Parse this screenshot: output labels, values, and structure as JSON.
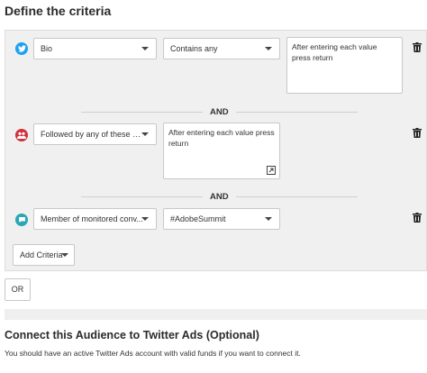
{
  "page": {
    "title": "Define the criteria"
  },
  "criteria": [
    {
      "icon": "twitter-bird-icon",
      "field": "Bio",
      "operator": "Contains any",
      "value_placeholder": "After entering each value press return"
    },
    {
      "icon": "followers-icon",
      "field": "Followed by any of these a...",
      "value_placeholder": "After entering each value press return"
    },
    {
      "icon": "monitored-conversation-icon",
      "field": "Member of monitored conv...",
      "value": "#AdobeSummit"
    }
  ],
  "connectors": [
    "AND",
    "AND"
  ],
  "buttons": {
    "add_criteria": "Add Criteria",
    "or": "OR"
  },
  "connect_section": {
    "title": "Connect this Audience to Twitter Ads (Optional)",
    "note": "You should have an active Twitter Ads account with valid funds if you want to connect it."
  },
  "colors": {
    "twitter_blue": "#1da1f2",
    "followers_red": "#d0313a",
    "monitored_teal": "#2aa6b5"
  }
}
